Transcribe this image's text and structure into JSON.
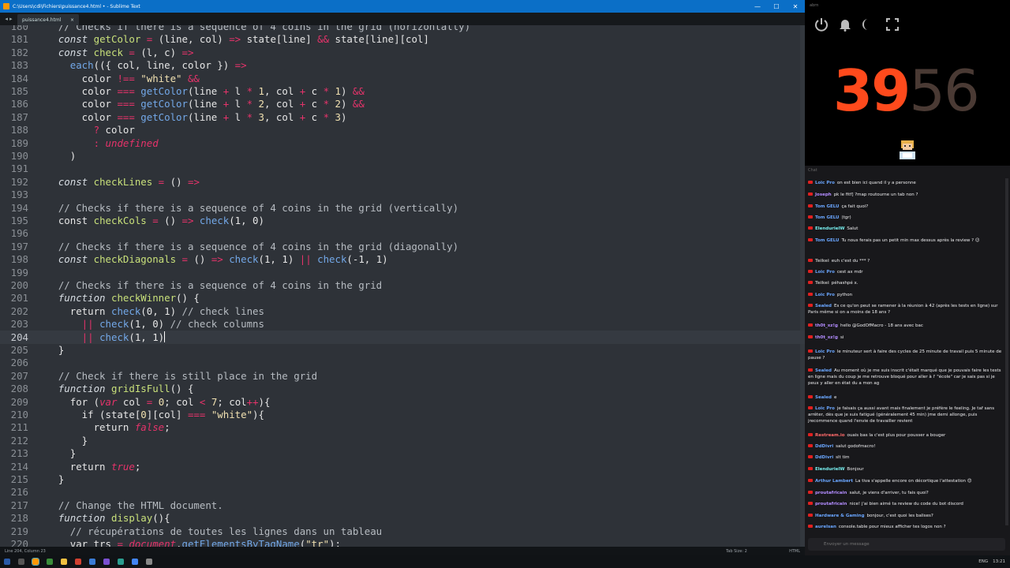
{
  "window": {
    "title": "C:\\Users\\cdi\\Fichiers\\puissance4.html • - Sublime Text",
    "minimize": "—",
    "maximize": "☐",
    "close": "✕",
    "tab_label": "puissance4.html",
    "tab_close": "×",
    "tab_arrows": "◂ ▸"
  },
  "status": {
    "left": "Line 204, Column 23",
    "tab_size": "Tab Size: 2",
    "syntax": "HTML"
  },
  "taskbar": {
    "lang": "ENG",
    "time": "13:21"
  },
  "colors": {
    "accent": "#0b6fc7",
    "editor_bg": "#2e3238",
    "timer_active": "#ff4a1c",
    "timer_dim": "#4a3a34"
  },
  "stream": {
    "top_label": "abrn",
    "timer_bright": "39",
    "timer_dim": "56"
  },
  "chat": {
    "header": "Chat",
    "input_placeholder": "Envoyer un message",
    "messages": [
      {
        "user": "Loïc Pro",
        "text": "on est bien ici quand il y a personne",
        "color": "#6aa6ff"
      },
      {
        "user": "Joseph",
        "text": "pk le fitf] ?map routourne un tab non ?",
        "color": "#b38cff"
      },
      {
        "user": "Tom GELU",
        "text": "ça fait quoi?",
        "color": "#6aa6ff"
      },
      {
        "user": "Tom GELU",
        "text": "(tgr)",
        "color": "#6aa6ff"
      },
      {
        "user": "ElendurielW",
        "text": "Salut",
        "color": "#7ee"
      },
      {
        "user": "Tom GELU",
        "text": "Tu nous ferais pas un petit min max dessus après la review ? 😉",
        "color": "#6aa6ff"
      },
      {
        "user": "Teikei",
        "text": "euh c'est du *** ?",
        "color": "#aaa"
      },
      {
        "user": "Loïc Pro",
        "text": "cest ax mdr",
        "color": "#6aa6ff"
      },
      {
        "user": "Teikei",
        "text": "péhashpé x.",
        "color": "#aaa"
      },
      {
        "user": "Loïc Pro",
        "text": "python",
        "color": "#6aa6ff"
      },
      {
        "user": "Sealed",
        "text": "Es ce qu'on peut se ramener à la réunion à 42 (après les tests en ligne) sur Paris même si on a moins de 18 ans ?",
        "color": "#6aa6ff"
      },
      {
        "user": "th0t_xz!g",
        "text": "hello @GodOfMacro - 18 ans avec bac",
        "color": "#b38cff"
      },
      {
        "user": "th0t_xz!g",
        "text": "si",
        "color": "#b38cff"
      },
      {
        "user": "Loïc Pro",
        "text": "le minuteur sert à faire des cycles de 25 minute de travail puis 5 minute de pause ?",
        "color": "#6aa6ff"
      },
      {
        "user": "Sealed",
        "text": "Au moment où je me suis inscrit c'était marqué que je pouvais faire les tests en ligne mais du coup je me retrouve bloqué pour aller à l' \"école\" car je sais pas si je peux y aller en état du a mon ag",
        "color": "#6aa6ff"
      },
      {
        "user": "Sealed",
        "text": "e",
        "color": "#6aa6ff"
      },
      {
        "user": "Loïc Pro",
        "text": "je faisais ça aussi avant mais finalement je préfère le feeling. Je taf sans arrêter, dès que je suis fatigué (généralement 45 min) jme demi allonge, puis jrecommence quand l'envie de travailler revient",
        "color": "#6aa6ff"
      },
      {
        "user": "Restream.io",
        "text": "ouais bas la c'est plus pour pousser a bouger",
        "color": "#ff6a6a"
      },
      {
        "user": "DdDivri",
        "text": "salut godofmacro!",
        "color": "#6aa6ff"
      },
      {
        "user": "DdDivri",
        "text": "slt tim",
        "color": "#6aa6ff"
      },
      {
        "user": "ElendurielW",
        "text": "Bonjour",
        "color": "#7ee"
      },
      {
        "user": "Arthur Lambert",
        "text": "La tiva s'appelle encore on décortique l'attestation 😊",
        "color": "#6aa6ff"
      },
      {
        "user": "proutafricain",
        "text": "salut, je viens d'arriver, tu fais quoi?",
        "color": "#b38cff"
      },
      {
        "user": "proutafricain",
        "text": "nice! j'ai bien aimé ta review du code du bot discord",
        "color": "#b38cff"
      },
      {
        "user": "Hardware & Gaming",
        "text": "bonjour, c'est quoi les balises?",
        "color": "#6aa6ff"
      },
      {
        "user": "aurelsan",
        "text": "console.table pour mieux afficher tes logos non ?",
        "color": "#6aa6ff"
      }
    ]
  },
  "code": [
    {
      "n": "180",
      "tokens": [
        [
          "cm",
          "    // Checks if there is a sequence of 4 coins in the grid (horizontally)"
        ]
      ]
    },
    {
      "n": "181",
      "tokens": [
        [
          "kw",
          "    const "
        ],
        [
          "fn",
          "getColor"
        ],
        [
          "op",
          " = "
        ],
        [
          "pl",
          "(line, col) "
        ],
        [
          "op",
          "=>"
        ],
        [
          "pl",
          " state[line] "
        ],
        [
          "op",
          "&&"
        ],
        [
          "pl",
          " state[line][col]"
        ]
      ]
    },
    {
      "n": "182",
      "tokens": [
        [
          "kw",
          "    const "
        ],
        [
          "fn",
          "check"
        ],
        [
          "op",
          " = "
        ],
        [
          "pl",
          "(l, c) "
        ],
        [
          "op",
          "=>"
        ]
      ]
    },
    {
      "n": "183",
      "tokens": [
        [
          "cl",
          "      each"
        ],
        [
          "pl",
          "(({ col, line, color }) "
        ],
        [
          "op",
          "=>"
        ]
      ]
    },
    {
      "n": "184",
      "tokens": [
        [
          "pl",
          "        color "
        ],
        [
          "op",
          "!=="
        ],
        [
          "st",
          " \"white\" "
        ],
        [
          "op",
          "&&"
        ]
      ]
    },
    {
      "n": "185",
      "tokens": [
        [
          "pl",
          "        color "
        ],
        [
          "op",
          "==="
        ],
        [
          "cl",
          " getColor"
        ],
        [
          "pl",
          "(line "
        ],
        [
          "op",
          "+"
        ],
        [
          "pl",
          " l "
        ],
        [
          "op",
          "*"
        ],
        [
          "nm",
          " 1"
        ],
        [
          "pl",
          ", col "
        ],
        [
          "op",
          "+"
        ],
        [
          "pl",
          " c "
        ],
        [
          "op",
          "*"
        ],
        [
          "nm",
          " 1"
        ],
        [
          "pl",
          ") "
        ],
        [
          "op",
          "&&"
        ]
      ]
    },
    {
      "n": "186",
      "tokens": [
        [
          "pl",
          "        color "
        ],
        [
          "op",
          "==="
        ],
        [
          "cl",
          " getColor"
        ],
        [
          "pl",
          "(line "
        ],
        [
          "op",
          "+"
        ],
        [
          "pl",
          " l "
        ],
        [
          "op",
          "*"
        ],
        [
          "nm",
          " 2"
        ],
        [
          "pl",
          ", col "
        ],
        [
          "op",
          "+"
        ],
        [
          "pl",
          " c "
        ],
        [
          "op",
          "*"
        ],
        [
          "nm",
          " 2"
        ],
        [
          "pl",
          ") "
        ],
        [
          "op",
          "&&"
        ]
      ]
    },
    {
      "n": "187",
      "tokens": [
        [
          "pl",
          "        color "
        ],
        [
          "op",
          "==="
        ],
        [
          "cl",
          " getColor"
        ],
        [
          "pl",
          "(line "
        ],
        [
          "op",
          "+"
        ],
        [
          "pl",
          " l "
        ],
        [
          "op",
          "*"
        ],
        [
          "nm",
          " 3"
        ],
        [
          "pl",
          ", col "
        ],
        [
          "op",
          "+"
        ],
        [
          "pl",
          " c "
        ],
        [
          "op",
          "*"
        ],
        [
          "nm",
          " 3"
        ],
        [
          "pl",
          ")"
        ]
      ]
    },
    {
      "n": "188",
      "tokens": [
        [
          "op",
          "          ?"
        ],
        [
          "pl",
          " color"
        ]
      ]
    },
    {
      "n": "189",
      "tokens": [
        [
          "op",
          "          :"
        ],
        [
          "it",
          " undefined"
        ]
      ]
    },
    {
      "n": "190",
      "tokens": [
        [
          "pl",
          "      )"
        ]
      ]
    },
    {
      "n": "191",
      "tokens": []
    },
    {
      "n": "192",
      "tokens": [
        [
          "kw",
          "    const "
        ],
        [
          "fn",
          "checkLines"
        ],
        [
          "op",
          " = "
        ],
        [
          "pl",
          "() "
        ],
        [
          "op",
          "=>"
        ]
      ]
    },
    {
      "n": "193",
      "tokens": []
    },
    {
      "n": "194",
      "tokens": [
        [
          "cm",
          "    // Checks if there is a sequence of 4 coins in the grid (vertically)"
        ]
      ]
    },
    {
      "n": "195",
      "tokens": [
        [
          "pl",
          "    const "
        ],
        [
          "fn",
          "checkCols"
        ],
        [
          "op",
          " = "
        ],
        [
          "pl",
          "() "
        ],
        [
          "op",
          "=>"
        ],
        [
          "cl",
          " check"
        ],
        [
          "pl",
          "(1, 0)"
        ]
      ]
    },
    {
      "n": "196",
      "tokens": []
    },
    {
      "n": "197",
      "tokens": [
        [
          "cm",
          "    // Checks if there is a sequence of 4 coins in the grid (diagonally)"
        ]
      ]
    },
    {
      "n": "198",
      "tokens": [
        [
          "kw",
          "    const "
        ],
        [
          "fn",
          "checkDiagonals"
        ],
        [
          "op",
          " = "
        ],
        [
          "pl",
          "() "
        ],
        [
          "op",
          "=>"
        ],
        [
          "cl",
          " check"
        ],
        [
          "pl",
          "(1, 1) "
        ],
        [
          "op",
          "||"
        ],
        [
          "cl",
          " check"
        ],
        [
          "pl",
          "(-1, 1)"
        ]
      ]
    },
    {
      "n": "199",
      "tokens": []
    },
    {
      "n": "200",
      "tokens": [
        [
          "cm",
          "    // Checks if there is a sequence of 4 coins in the grid"
        ]
      ]
    },
    {
      "n": "201",
      "tokens": [
        [
          "kw",
          "    function "
        ],
        [
          "fn",
          "checkWinner"
        ],
        [
          "pl",
          "() {"
        ]
      ]
    },
    {
      "n": "202",
      "tokens": [
        [
          "pl",
          "      return "
        ],
        [
          "cl",
          "check"
        ],
        [
          "pl",
          "(0, 1) "
        ],
        [
          "cm",
          "// check lines"
        ]
      ]
    },
    {
      "n": "203",
      "tokens": [
        [
          "op",
          "        ||"
        ],
        [
          "cl",
          " check"
        ],
        [
          "pl",
          "(1, 0) "
        ],
        [
          "cm",
          "// check columns"
        ]
      ]
    },
    {
      "n": "204",
      "tokens": [
        [
          "op",
          "        ||"
        ],
        [
          "cl",
          " check"
        ],
        [
          "pl",
          "(1, 1)"
        ]
      ],
      "cursor": true
    },
    {
      "n": "205",
      "tokens": [
        [
          "pl",
          "    }"
        ]
      ]
    },
    {
      "n": "206",
      "tokens": []
    },
    {
      "n": "207",
      "tokens": [
        [
          "cm",
          "    // Check if there is still place in the grid"
        ]
      ]
    },
    {
      "n": "208",
      "tokens": [
        [
          "kw",
          "    function "
        ],
        [
          "fn",
          "gridIsFull"
        ],
        [
          "pl",
          "() {"
        ]
      ]
    },
    {
      "n": "209",
      "tokens": [
        [
          "pl",
          "      for ("
        ],
        [
          "it",
          "var"
        ],
        [
          "pl",
          " col "
        ],
        [
          "op",
          "="
        ],
        [
          "nm",
          " 0"
        ],
        [
          "pl",
          "; col "
        ],
        [
          "op",
          "<"
        ],
        [
          "nm",
          " 7"
        ],
        [
          "pl",
          "; col"
        ],
        [
          "op",
          "++"
        ],
        [
          "pl",
          "){"
        ]
      ]
    },
    {
      "n": "210",
      "tokens": [
        [
          "pl",
          "        if (state["
        ],
        [
          "nm",
          "0"
        ],
        [
          "pl",
          "][col] "
        ],
        [
          "op",
          "==="
        ],
        [
          "st",
          " \"white\""
        ],
        [
          "pl",
          "){"
        ]
      ]
    },
    {
      "n": "211",
      "tokens": [
        [
          "pl",
          "          return "
        ],
        [
          "it",
          "false"
        ],
        [
          "pl",
          ";"
        ]
      ]
    },
    {
      "n": "212",
      "tokens": [
        [
          "pl",
          "        }"
        ]
      ]
    },
    {
      "n": "213",
      "tokens": [
        [
          "pl",
          "      }"
        ]
      ]
    },
    {
      "n": "214",
      "tokens": [
        [
          "pl",
          "      return "
        ],
        [
          "it",
          "true"
        ],
        [
          "pl",
          ";"
        ]
      ]
    },
    {
      "n": "215",
      "tokens": [
        [
          "pl",
          "    }"
        ]
      ]
    },
    {
      "n": "216",
      "tokens": []
    },
    {
      "n": "217",
      "tokens": [
        [
          "cm",
          "    // Change the HTML document."
        ]
      ]
    },
    {
      "n": "218",
      "tokens": [
        [
          "kw",
          "    function "
        ],
        [
          "fn",
          "display"
        ],
        [
          "pl",
          "(){"
        ]
      ]
    },
    {
      "n": "219",
      "tokens": [
        [
          "cm",
          "      // récupérations de toutes les lignes dans un tableau"
        ]
      ]
    },
    {
      "n": "220",
      "tokens": [
        [
          "pl",
          "      var trs "
        ],
        [
          "op",
          "="
        ],
        [
          "it",
          " document"
        ],
        [
          "pl",
          "."
        ],
        [
          "cl",
          "getElementsByTagName"
        ],
        [
          "pl",
          "("
        ],
        [
          "st",
          "\"tr\""
        ],
        [
          "pl",
          ");"
        ]
      ]
    }
  ]
}
